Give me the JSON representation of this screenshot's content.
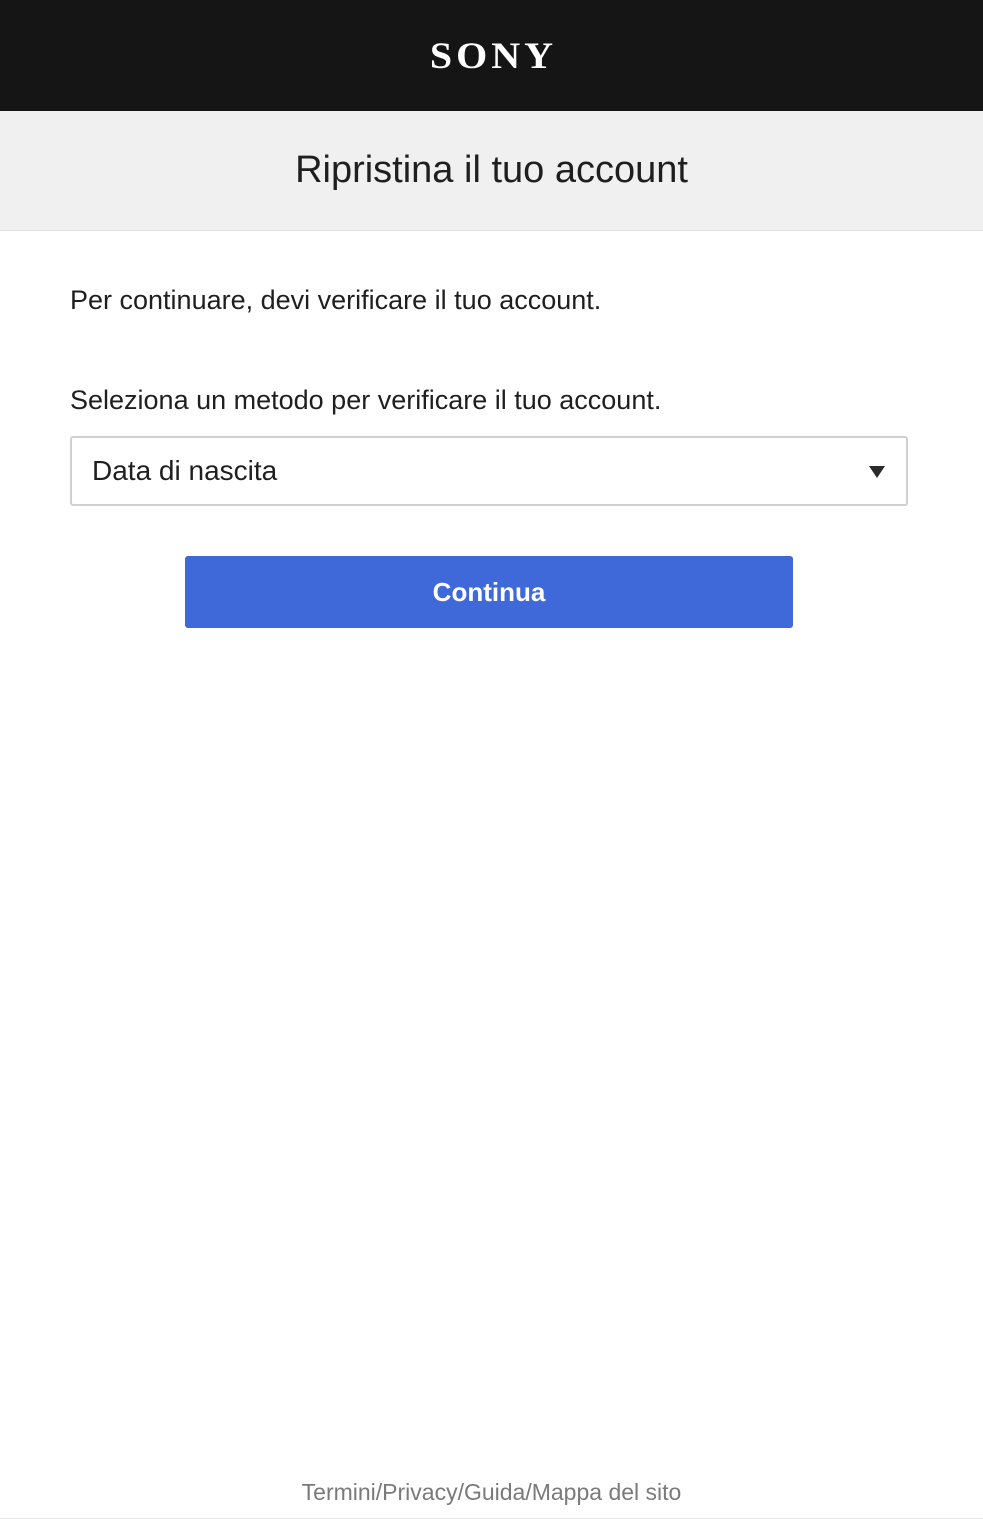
{
  "header": {
    "logo_text": "SONY"
  },
  "title_bar": {
    "title": "Ripristina il tuo account"
  },
  "main": {
    "intro_text": "Per continuare, devi verificare il tuo account.",
    "method_label": "Seleziona un metodo per verificare il tuo account.",
    "method_select": {
      "selected_value": "Data di nascita"
    },
    "continue_label": "Continua"
  },
  "footer": {
    "links": [
      "Termini",
      "Privacy",
      "Guida",
      "Mappa del sito"
    ],
    "separator": "/"
  },
  "colors": {
    "header_bg": "#151515",
    "title_bar_bg": "#f0f0f0",
    "accent_button": "#3f69d8",
    "footer_text": "#7a7a7a"
  }
}
